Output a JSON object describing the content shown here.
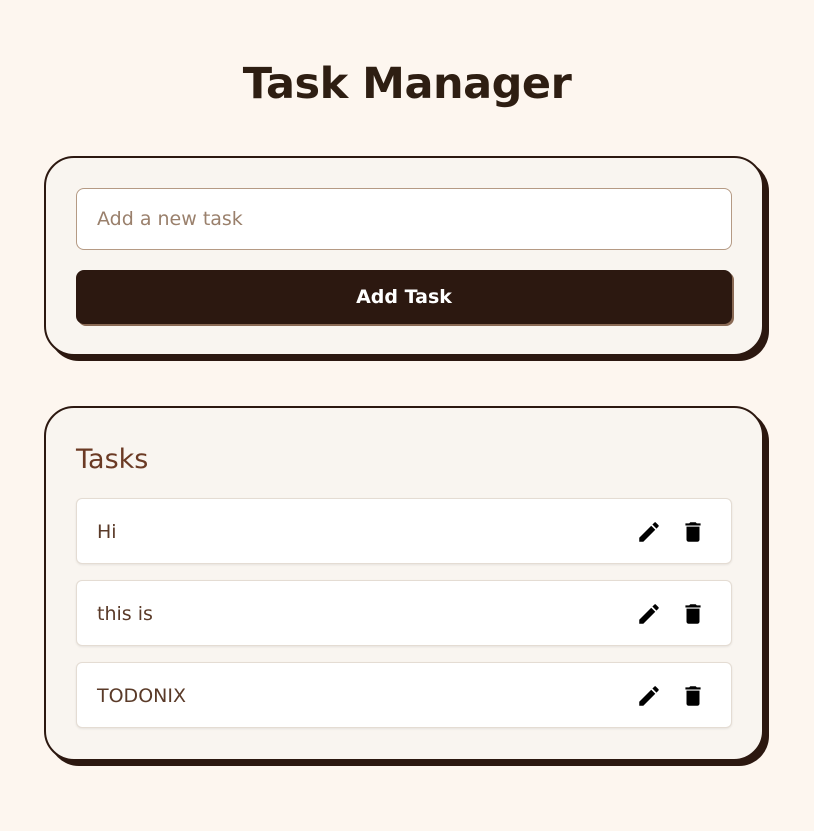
{
  "page": {
    "title": "Task Manager"
  },
  "add_form": {
    "input_placeholder": "Add a new task",
    "input_value": "",
    "button_label": "Add Task"
  },
  "tasks": {
    "heading": "Tasks",
    "items": [
      {
        "text": "Hi",
        "edit_icon": "pencil-icon",
        "delete_icon": "trash-icon"
      },
      {
        "text": "this is",
        "edit_icon": "pencil-icon",
        "delete_icon": "trash-icon"
      },
      {
        "text": "TODONIX",
        "edit_icon": "pencil-icon",
        "delete_icon": "trash-icon"
      }
    ]
  },
  "colors": {
    "background": "#fdf6ef",
    "card": "#f9f5f0",
    "primary_dark": "#2c1810",
    "heading_accent": "#6b3a24",
    "task_text": "#5a3a28"
  }
}
